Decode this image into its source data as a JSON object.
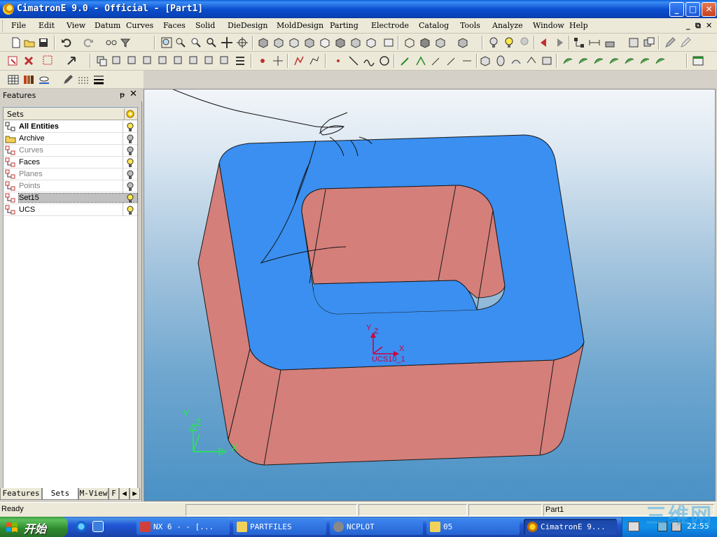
{
  "window": {
    "title": "CimatronE 9.0 - Official - [Part1]",
    "min_glyph": "_",
    "max_glyph": "□",
    "close_glyph": "✕"
  },
  "menubar": {
    "items": [
      "File",
      "Edit",
      "View",
      "Datum",
      "Curves",
      "Faces",
      "Solid",
      "DieDesign",
      "MoldDesign",
      "Parting",
      "Electrode",
      "Catalog",
      "Tools",
      "Analyze",
      "Window",
      "Help"
    ],
    "mdi_min": "_",
    "mdi_restore": "⧉",
    "mdi_close": "✕"
  },
  "panel": {
    "title": "Features",
    "pin_glyph": "ᵽ",
    "close_glyph": "✕",
    "sets_header": "Sets",
    "rows": [
      {
        "label": "All Entities",
        "style": "bold",
        "bulb": "on"
      },
      {
        "label": "Archive",
        "style": "normal",
        "bulb": "off"
      },
      {
        "label": "Curves",
        "style": "dim",
        "bulb": "off"
      },
      {
        "label": "Faces",
        "style": "normal",
        "bulb": "on"
      },
      {
        "label": "Planes",
        "style": "dim",
        "bulb": "off"
      },
      {
        "label": "Points",
        "style": "dim",
        "bulb": "off"
      },
      {
        "label": "Set15",
        "style": "selected",
        "bulb": "on"
      },
      {
        "label": "UCS",
        "style": "normal",
        "bulb": "on"
      }
    ],
    "tabs": [
      "Features",
      "Sets",
      "M-View",
      "F"
    ],
    "tab_prev": "◀",
    "tab_next": "▶"
  },
  "viewport": {
    "ucs_local_label": "UCS10_1",
    "axis_x": "X",
    "axis_y": "Y",
    "axis_z": "Z",
    "colors": {
      "top_face": "#3a8ff0",
      "side_face": "#d47f7a",
      "outline": "#1a1a1a",
      "ucs_local": "#d0003a",
      "ucs_global": "#22ee44"
    }
  },
  "statusbar": {
    "message": "Ready",
    "part_name": "Part1"
  },
  "taskbar": {
    "start_label": "开始",
    "tasks": [
      {
        "label": "NX 6 - - [...",
        "icon": "nx-icon"
      },
      {
        "label": "PARTFILES",
        "icon": "folder-icon"
      },
      {
        "label": "NCPLOT",
        "icon": "ncplot-icon"
      },
      {
        "label": "05",
        "icon": "folder-icon"
      },
      {
        "label": "CimatronE 9...",
        "icon": "cimatron-icon",
        "active": true
      }
    ],
    "clock": "22:55",
    "watermark": "三维网"
  }
}
